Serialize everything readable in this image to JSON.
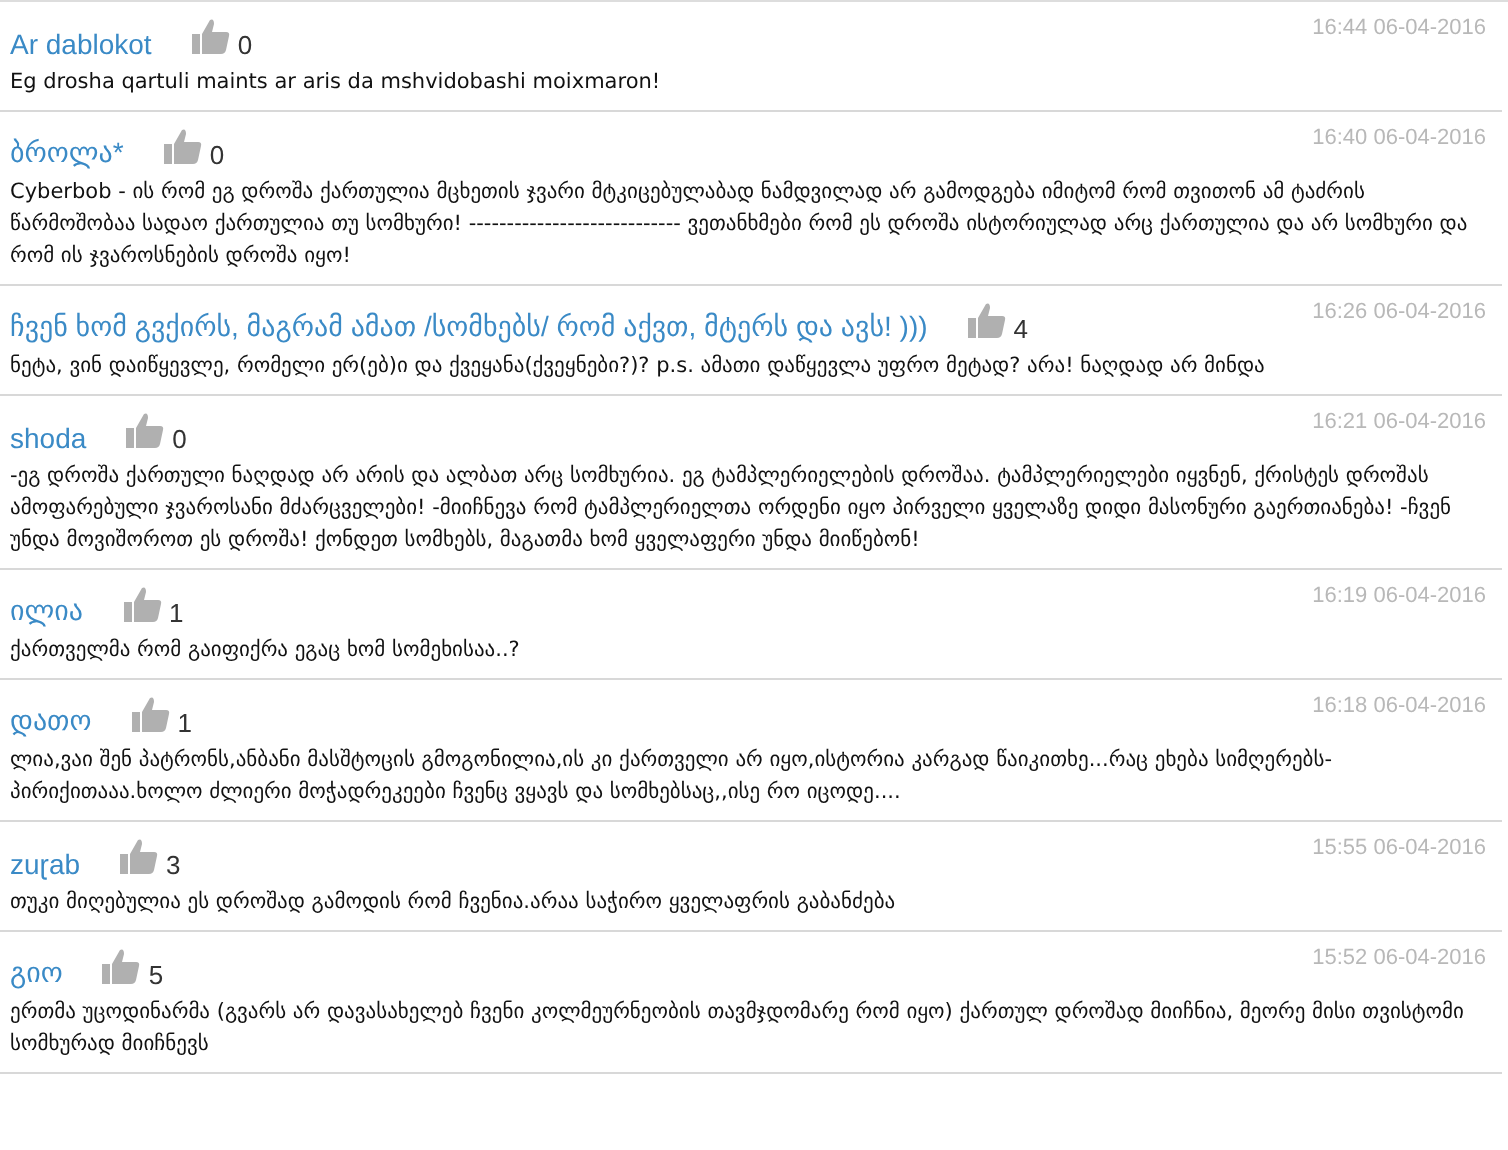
{
  "comments": [
    {
      "author": "Ar dablokot",
      "likes": "0",
      "time": "16:44 06-04-2016",
      "text": "Eg drosha qartuli maints ar aris da mshvidobashi moixmaron!"
    },
    {
      "author": "ბროლა*",
      "likes": "0",
      "time": "16:40 06-04-2016",
      "text": "Cyberbob - ის რომ ეგ დროშა ქართულია მცხეთის ჯვარი მტკიცებულაბად ნამდვილად არ გამოდგება იმიტომ რომ თვითონ ამ ტაძრის წარმოშობაა სადაო ქართულია თუ სომხური! ---------------------------- ვეთანხმები რომ ეს დროშა ისტორიულად არც ქართულია და არ სომხური და რომ ის ჯვაროსნების დროშა იყო!"
    },
    {
      "author": "ჩვენ ხომ გვქირს, მაგრამ ამათ /სომხებს/ რომ აქვთ, მტერს და ავს! )))",
      "likes": "4",
      "time": "16:26 06-04-2016",
      "text": "ნეტა, ვინ დაიწყევლე, რომელი ერ(ებ)ი და ქვეყანა(ქვეყნები?)? p.s. ამათი დაწყევლა უფრო მეტად? არა! ნაღდად არ მინდა"
    },
    {
      "author": "shoda",
      "likes": "0",
      "time": "16:21 06-04-2016",
      "text": "-ეგ დროშა ქართული ნაღდად არ არის და ალბათ არც სომხურია. ეგ ტამპლერიელების დროშაა. ტამპლერიელები იყვნენ, ქრისტეს დროშას ამოფარებული ჯვაროსანი მძარცველები! -მიიჩნევა რომ ტამპლერიელთა ორდენი იყო პირველი ყველაზე დიდი მასონური გაერთიანება! -ჩვენ უნდა მოვიშოროთ ეს დროშა! ქონდეთ სომხებს, მაგათმა ხომ ყველაფერი უნდა მიიწებონ!"
    },
    {
      "author": "ილია",
      "likes": "1",
      "time": "16:19 06-04-2016",
      "text": "ქართველმა რომ გაიფიქრა ეგაც ხომ სომეხისაა..?"
    },
    {
      "author": "დათო",
      "likes": "1",
      "time": "16:18 06-04-2016",
      "text": "ლია,ვაი შენ პატრონს,ანბანი მასშტოცის გმოგონილია,ის კი ქართველი არ იყო,ისტორია კარგად წაიკითხე...რაც ეხება სიმღერებს-პირიქითააა.ხოლო ძლიერი მოჭადრეკეები ჩვენც ვყავს და სომხებსაც,,ისე რო იცოდე...."
    },
    {
      "author": "zuɽab",
      "likes": "3",
      "time": "15:55 06-04-2016",
      "text": "თუკი მიღებულია ეს დროშად გამოდის რომ ჩვენია.არაა საჭირო ყველაფრის გაბანძება"
    },
    {
      "author": "გიო",
      "likes": "5",
      "time": "15:52 06-04-2016",
      "text": "ერთმა უცოდინარმა (გვარს არ დავასახელებ ჩვენი კოლმეურნეობის თავმჯდომარე რომ იყო) ქართულ დროშად მიიჩნია, მეორე მისი თვისტომი სომხურად მიიჩნევს"
    }
  ]
}
